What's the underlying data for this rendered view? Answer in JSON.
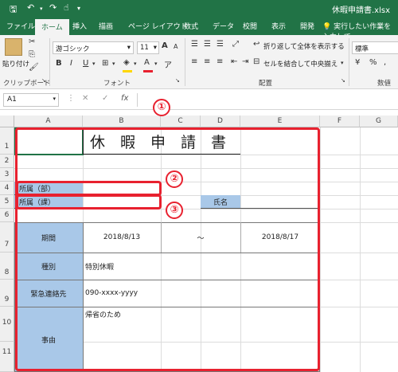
{
  "window": {
    "title": "休暇申請書.xlsx"
  },
  "qat": {
    "save_icon": "save-icon",
    "undo_icon": "undo-icon",
    "redo_icon": "redo-icon",
    "touch_icon": "touch-mode-icon",
    "customize": "▾"
  },
  "tabs": [
    "ファイル",
    "ホーム",
    "挿入",
    "描画",
    "ページ レイアウト",
    "数式",
    "データ",
    "校閲",
    "表示",
    "開発"
  ],
  "tell_me": "実行したい作業を入力して",
  "ribbon": {
    "paste_label": "貼り付け",
    "clipboard_label": "クリップボード",
    "font_label": "フォント",
    "alignment_label": "配置",
    "number_label": "数値",
    "font_name": "游ゴシック",
    "font_size": "11",
    "bold": "B",
    "italic": "I",
    "underline": "U",
    "grow_font": "A",
    "shrink_font": "A",
    "font_color_letter": "A",
    "wrap_text": "折り返して全体を表示する",
    "merge_center": "セルを結合して中央揃え",
    "number_format": "標準",
    "percent": "%",
    "comma": ","
  },
  "formula_bar": {
    "name_box": "A1",
    "cancel": "✕",
    "enter": "✓",
    "fx": "fx",
    "value": ""
  },
  "columns": [
    "A",
    "B",
    "C",
    "D",
    "E",
    "F",
    "G"
  ],
  "rows": [
    "1",
    "2",
    "3",
    "4",
    "5",
    "6",
    "7",
    "8",
    "9",
    "10",
    "11"
  ],
  "sheet": {
    "title": "休　暇　申　請　書",
    "dept": "所属（部）",
    "section": "所属（課）",
    "name_label": "氏名",
    "period_label": "期間",
    "start_date": "2018/8/13",
    "tilde": "～",
    "end_date": "2018/8/17",
    "type_label": "種別",
    "type_value": "特別休暇",
    "contact_label": "緊急連絡先",
    "contact_value": "090-xxxx-yyyy",
    "reason_label": "事由",
    "reason_value": "帰省のため"
  },
  "callouts": [
    "①",
    "②",
    "③"
  ],
  "colors": {
    "excel_green": "#217346",
    "accent_red": "#e8212f",
    "label_blue": "#a9c8e8"
  }
}
